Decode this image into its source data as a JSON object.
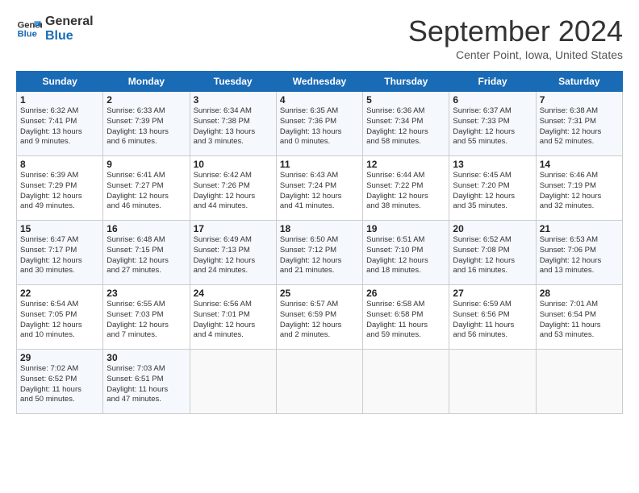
{
  "header": {
    "logo_line1": "General",
    "logo_line2": "Blue",
    "month_title": "September 2024",
    "subtitle": "Center Point, Iowa, United States"
  },
  "weekdays": [
    "Sunday",
    "Monday",
    "Tuesday",
    "Wednesday",
    "Thursday",
    "Friday",
    "Saturday"
  ],
  "weeks": [
    [
      {
        "day": "1",
        "info": "Sunrise: 6:32 AM\nSunset: 7:41 PM\nDaylight: 13 hours\nand 9 minutes."
      },
      {
        "day": "2",
        "info": "Sunrise: 6:33 AM\nSunset: 7:39 PM\nDaylight: 13 hours\nand 6 minutes."
      },
      {
        "day": "3",
        "info": "Sunrise: 6:34 AM\nSunset: 7:38 PM\nDaylight: 13 hours\nand 3 minutes."
      },
      {
        "day": "4",
        "info": "Sunrise: 6:35 AM\nSunset: 7:36 PM\nDaylight: 13 hours\nand 0 minutes."
      },
      {
        "day": "5",
        "info": "Sunrise: 6:36 AM\nSunset: 7:34 PM\nDaylight: 12 hours\nand 58 minutes."
      },
      {
        "day": "6",
        "info": "Sunrise: 6:37 AM\nSunset: 7:33 PM\nDaylight: 12 hours\nand 55 minutes."
      },
      {
        "day": "7",
        "info": "Sunrise: 6:38 AM\nSunset: 7:31 PM\nDaylight: 12 hours\nand 52 minutes."
      }
    ],
    [
      {
        "day": "8",
        "info": "Sunrise: 6:39 AM\nSunset: 7:29 PM\nDaylight: 12 hours\nand 49 minutes."
      },
      {
        "day": "9",
        "info": "Sunrise: 6:41 AM\nSunset: 7:27 PM\nDaylight: 12 hours\nand 46 minutes."
      },
      {
        "day": "10",
        "info": "Sunrise: 6:42 AM\nSunset: 7:26 PM\nDaylight: 12 hours\nand 44 minutes."
      },
      {
        "day": "11",
        "info": "Sunrise: 6:43 AM\nSunset: 7:24 PM\nDaylight: 12 hours\nand 41 minutes."
      },
      {
        "day": "12",
        "info": "Sunrise: 6:44 AM\nSunset: 7:22 PM\nDaylight: 12 hours\nand 38 minutes."
      },
      {
        "day": "13",
        "info": "Sunrise: 6:45 AM\nSunset: 7:20 PM\nDaylight: 12 hours\nand 35 minutes."
      },
      {
        "day": "14",
        "info": "Sunrise: 6:46 AM\nSunset: 7:19 PM\nDaylight: 12 hours\nand 32 minutes."
      }
    ],
    [
      {
        "day": "15",
        "info": "Sunrise: 6:47 AM\nSunset: 7:17 PM\nDaylight: 12 hours\nand 30 minutes."
      },
      {
        "day": "16",
        "info": "Sunrise: 6:48 AM\nSunset: 7:15 PM\nDaylight: 12 hours\nand 27 minutes."
      },
      {
        "day": "17",
        "info": "Sunrise: 6:49 AM\nSunset: 7:13 PM\nDaylight: 12 hours\nand 24 minutes."
      },
      {
        "day": "18",
        "info": "Sunrise: 6:50 AM\nSunset: 7:12 PM\nDaylight: 12 hours\nand 21 minutes."
      },
      {
        "day": "19",
        "info": "Sunrise: 6:51 AM\nSunset: 7:10 PM\nDaylight: 12 hours\nand 18 minutes."
      },
      {
        "day": "20",
        "info": "Sunrise: 6:52 AM\nSunset: 7:08 PM\nDaylight: 12 hours\nand 16 minutes."
      },
      {
        "day": "21",
        "info": "Sunrise: 6:53 AM\nSunset: 7:06 PM\nDaylight: 12 hours\nand 13 minutes."
      }
    ],
    [
      {
        "day": "22",
        "info": "Sunrise: 6:54 AM\nSunset: 7:05 PM\nDaylight: 12 hours\nand 10 minutes."
      },
      {
        "day": "23",
        "info": "Sunrise: 6:55 AM\nSunset: 7:03 PM\nDaylight: 12 hours\nand 7 minutes."
      },
      {
        "day": "24",
        "info": "Sunrise: 6:56 AM\nSunset: 7:01 PM\nDaylight: 12 hours\nand 4 minutes."
      },
      {
        "day": "25",
        "info": "Sunrise: 6:57 AM\nSunset: 6:59 PM\nDaylight: 12 hours\nand 2 minutes."
      },
      {
        "day": "26",
        "info": "Sunrise: 6:58 AM\nSunset: 6:58 PM\nDaylight: 11 hours\nand 59 minutes."
      },
      {
        "day": "27",
        "info": "Sunrise: 6:59 AM\nSunset: 6:56 PM\nDaylight: 11 hours\nand 56 minutes."
      },
      {
        "day": "28",
        "info": "Sunrise: 7:01 AM\nSunset: 6:54 PM\nDaylight: 11 hours\nand 53 minutes."
      }
    ],
    [
      {
        "day": "29",
        "info": "Sunrise: 7:02 AM\nSunset: 6:52 PM\nDaylight: 11 hours\nand 50 minutes."
      },
      {
        "day": "30",
        "info": "Sunrise: 7:03 AM\nSunset: 6:51 PM\nDaylight: 11 hours\nand 47 minutes."
      },
      {
        "day": "",
        "info": ""
      },
      {
        "day": "",
        "info": ""
      },
      {
        "day": "",
        "info": ""
      },
      {
        "day": "",
        "info": ""
      },
      {
        "day": "",
        "info": ""
      }
    ]
  ]
}
